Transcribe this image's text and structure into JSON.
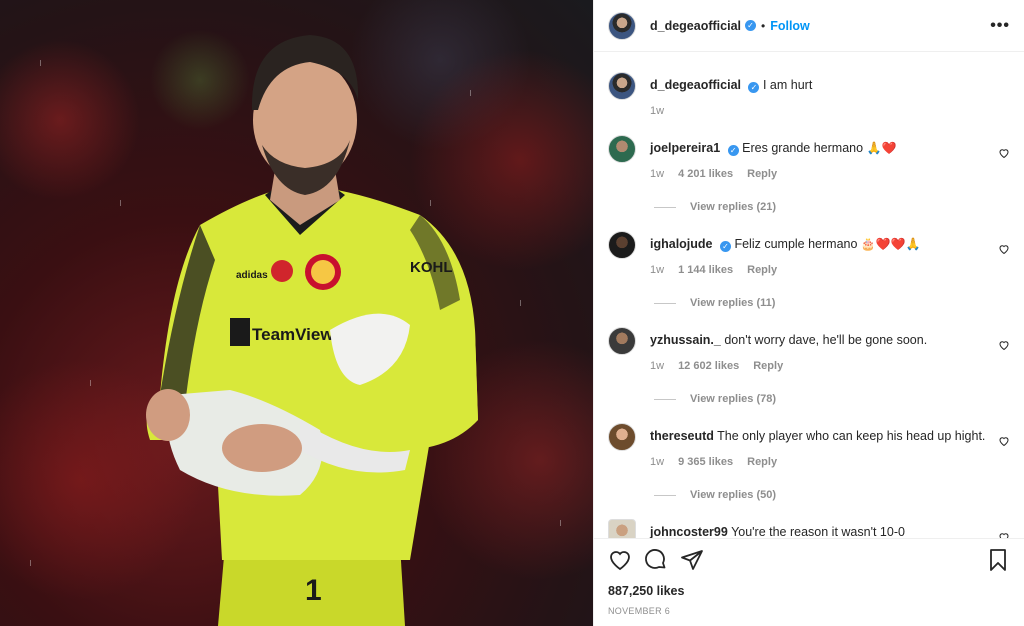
{
  "post": {
    "username": "d_degeaofficial",
    "follow_label": "Follow",
    "dot": "•",
    "more_label": "•••",
    "caption": "I am hurt",
    "caption_time": "1w",
    "likes": "887,250 likes",
    "date": "NOVEMBER 6"
  },
  "comments": [
    {
      "user": "joelpereira1",
      "verified": true,
      "text": "Eres grande hermano",
      "emoji": "🙏❤️",
      "time": "1w",
      "likes": "4 201 likes",
      "reply": "Reply",
      "view_replies": "View replies (21)"
    },
    {
      "user": "ighalojude",
      "verified": true,
      "text": "Feliz cumple hermano",
      "emoji": "🎂❤️❤️🙏",
      "time": "1w",
      "likes": "1 144 likes",
      "reply": "Reply",
      "view_replies": "View replies (11)"
    },
    {
      "user": "yzhussain._",
      "verified": false,
      "text": "don't worry dave, he'll be gone soon.",
      "emoji": "",
      "time": "1w",
      "likes": "12 602 likes",
      "reply": "Reply",
      "view_replies": "View replies (78)"
    },
    {
      "user": "thereseutd",
      "verified": false,
      "text": "The only player who can keep his head up hight.",
      "emoji": "",
      "time": "1w",
      "likes": "9 365 likes",
      "reply": "Reply",
      "view_replies": "View replies (50)"
    },
    {
      "user": "johncoster99",
      "verified": false,
      "text": "You're the reason it wasn't 10-0",
      "emoji": "",
      "time": "",
      "likes": "",
      "reply": "",
      "view_replies": ""
    }
  ],
  "icons": {
    "like": "heart-icon",
    "comment": "comment-icon",
    "share": "share-icon",
    "save": "bookmark-icon"
  },
  "colors": {
    "accent": "#0095f6",
    "verified": "#3897f0",
    "muted": "#8e8e8e",
    "jersey": "#d8e83a"
  }
}
